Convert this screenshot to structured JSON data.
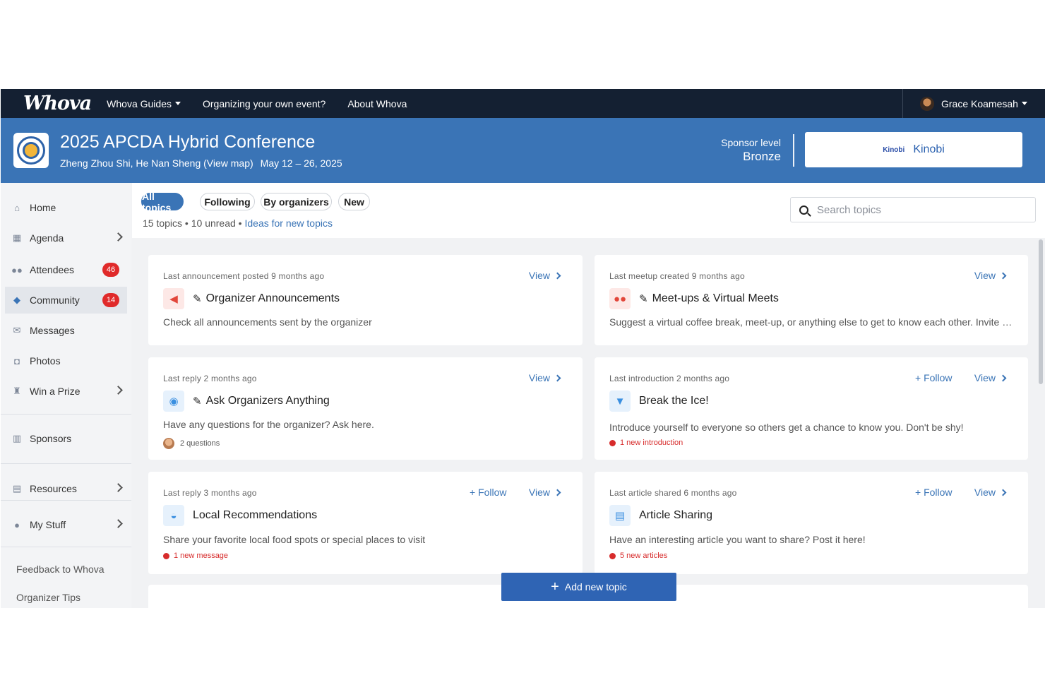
{
  "nav": {
    "logo": "Whova",
    "links": [
      "Whova Guides",
      "Organizing your own event?",
      "About Whova"
    ],
    "user_name": "Grace Koamesah"
  },
  "event": {
    "title": "2025 APCDA Hybrid Conference",
    "location": "Zheng Zhou Shi, He Nan Sheng (View map)",
    "dates": "May 12 – 26, 2025",
    "sponsor_label": "Sponsor level",
    "sponsor_level": "Bronze",
    "sponsor_mark": "Kinobi",
    "sponsor_name": "Kinobi"
  },
  "sidebar": {
    "items": [
      {
        "label": "Home",
        "icon": "home-icon"
      },
      {
        "label": "Agenda",
        "icon": "calendar-icon"
      },
      {
        "label": "Attendees",
        "icon": "people-icon",
        "badge": "46"
      },
      {
        "label": "Community",
        "icon": "chat-icon",
        "badge": "14"
      },
      {
        "label": "Messages",
        "icon": "envelope-icon"
      },
      {
        "label": "Photos",
        "icon": "camera-icon"
      },
      {
        "label": "Win a Prize",
        "icon": "trophy-icon"
      },
      {
        "label": "Sponsors",
        "icon": "building-icon"
      },
      {
        "label": "Resources",
        "icon": "briefcase-icon"
      },
      {
        "label": "My Stuff",
        "icon": "user-icon"
      }
    ],
    "footer": [
      "Feedback to Whova",
      "Organizer Tips"
    ]
  },
  "filters": {
    "pills": [
      "All topics",
      "Following",
      "By organizers",
      "New"
    ],
    "topics_count": "15 topics",
    "unread_count": "10 unread",
    "ideas_link": "Ideas for new topics",
    "search_placeholder": "Search topics"
  },
  "cards": [
    {
      "meta": "Last announcement posted 9 months ago",
      "title": "Organizer Announcements",
      "desc": "Check all announcements sent by the organizer",
      "view": "View"
    },
    {
      "meta": "Last meetup created 9 months ago",
      "title": "Meet-ups & Virtual Meets",
      "desc": "Suggest a virtual coffee break, meet-up, or anything else to get to know each other. Invite others to join!",
      "view": "View"
    },
    {
      "meta": "Last reply 2 months ago",
      "title": "Ask Organizers Anything",
      "desc": "Have any questions for the organizer? Ask here.",
      "extra": "2 questions",
      "view": "View"
    },
    {
      "meta": "Last introduction 2 months ago",
      "title": "Break the Ice!",
      "desc": "Introduce yourself to everyone so others get a chance to know you. Don't be shy!",
      "extra": "1 new introduction",
      "follow": "+ Follow",
      "view": "View"
    },
    {
      "meta": "Last reply 3 months ago",
      "title": "Local Recommendations",
      "desc": "Share your favorite local food spots or special places to visit",
      "extra": "1 new message",
      "follow": "+ Follow",
      "view": "View"
    },
    {
      "meta": "Last article shared 6 months ago",
      "title": "Article Sharing",
      "desc": "Have an interesting article you want to share? Post it here!",
      "extra": "5 new articles",
      "follow": "+ Follow",
      "view": "View"
    }
  ],
  "add_button": "Add new topic",
  "colors": {
    "nav_bg": "#142032",
    "banner_bg": "#3a74b6",
    "accent": "#3a74b6",
    "badge": "#e02a2a"
  }
}
